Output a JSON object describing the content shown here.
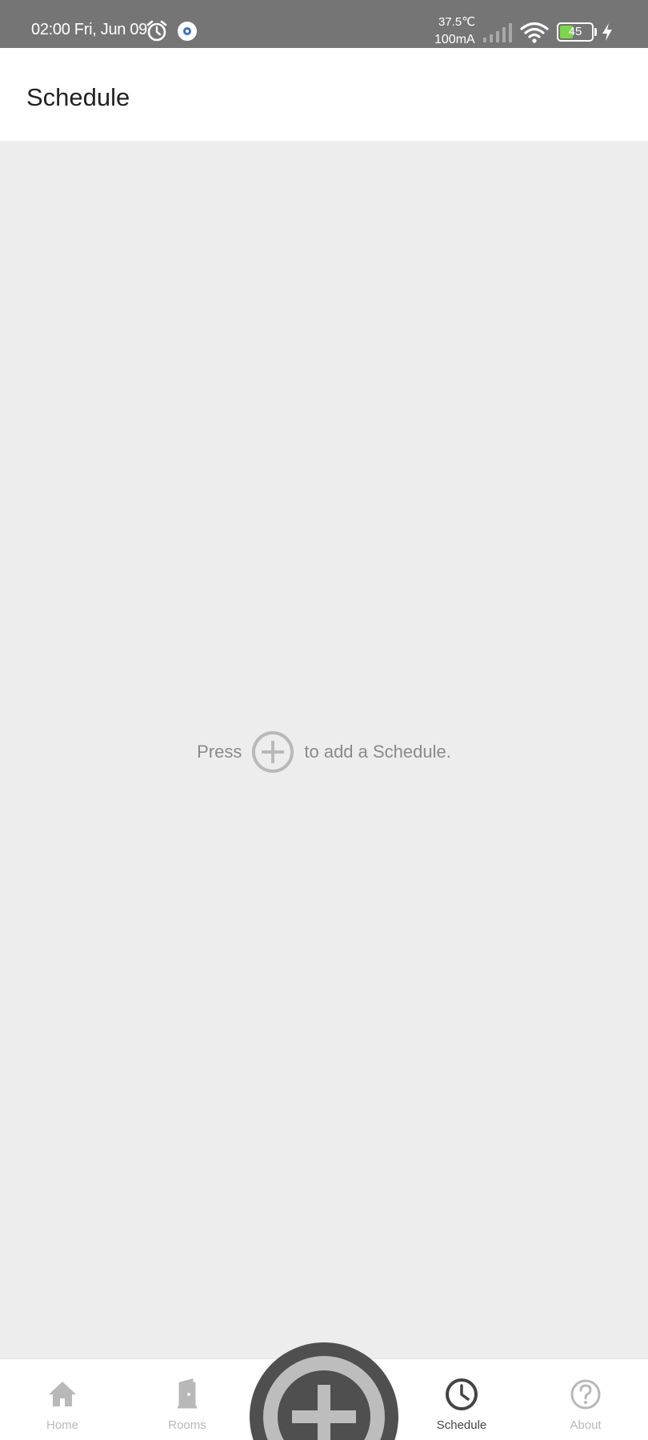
{
  "status_bar": {
    "time": "02:00 Fri, Jun 09",
    "temperature": "37.5℃",
    "current": "100mA",
    "battery_level": "45",
    "icons": [
      "alarm-clock-icon",
      "gear-icon",
      "signal-icon",
      "wifi-icon",
      "battery-icon",
      "charging-bolt-icon"
    ],
    "battery_color": "#7cd54a"
  },
  "app_bar": {
    "title": "Schedule"
  },
  "empty_state": {
    "prefix": "Press",
    "suffix": "to add a Schedule.",
    "icon": "plus-circle-icon"
  },
  "bottom_nav": {
    "items": [
      {
        "label": "Home",
        "icon": "home-icon",
        "active": false
      },
      {
        "label": "Rooms",
        "icon": "door-icon",
        "active": false
      },
      {
        "label": "Schedule",
        "icon": "clock-icon",
        "active": true
      },
      {
        "label": "About",
        "icon": "question-icon",
        "active": false
      }
    ],
    "fab_icon": "plus-icon",
    "active_color": "#444444",
    "inactive_color": "#b8b8b8"
  }
}
